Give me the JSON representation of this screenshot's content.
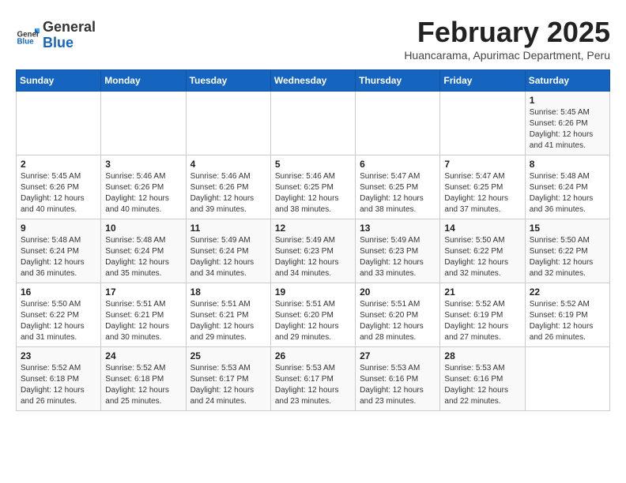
{
  "header": {
    "logo_general": "General",
    "logo_blue": "Blue",
    "month_title": "February 2025",
    "location": "Huancarama, Apurimac Department, Peru"
  },
  "weekdays": [
    "Sunday",
    "Monday",
    "Tuesday",
    "Wednesday",
    "Thursday",
    "Friday",
    "Saturday"
  ],
  "weeks": [
    [
      {
        "day": "",
        "info": ""
      },
      {
        "day": "",
        "info": ""
      },
      {
        "day": "",
        "info": ""
      },
      {
        "day": "",
        "info": ""
      },
      {
        "day": "",
        "info": ""
      },
      {
        "day": "",
        "info": ""
      },
      {
        "day": "1",
        "info": "Sunrise: 5:45 AM\nSunset: 6:26 PM\nDaylight: 12 hours\nand 41 minutes."
      }
    ],
    [
      {
        "day": "2",
        "info": "Sunrise: 5:45 AM\nSunset: 6:26 PM\nDaylight: 12 hours\nand 40 minutes."
      },
      {
        "day": "3",
        "info": "Sunrise: 5:46 AM\nSunset: 6:26 PM\nDaylight: 12 hours\nand 40 minutes."
      },
      {
        "day": "4",
        "info": "Sunrise: 5:46 AM\nSunset: 6:26 PM\nDaylight: 12 hours\nand 39 minutes."
      },
      {
        "day": "5",
        "info": "Sunrise: 5:46 AM\nSunset: 6:25 PM\nDaylight: 12 hours\nand 38 minutes."
      },
      {
        "day": "6",
        "info": "Sunrise: 5:47 AM\nSunset: 6:25 PM\nDaylight: 12 hours\nand 38 minutes."
      },
      {
        "day": "7",
        "info": "Sunrise: 5:47 AM\nSunset: 6:25 PM\nDaylight: 12 hours\nand 37 minutes."
      },
      {
        "day": "8",
        "info": "Sunrise: 5:48 AM\nSunset: 6:24 PM\nDaylight: 12 hours\nand 36 minutes."
      }
    ],
    [
      {
        "day": "9",
        "info": "Sunrise: 5:48 AM\nSunset: 6:24 PM\nDaylight: 12 hours\nand 36 minutes."
      },
      {
        "day": "10",
        "info": "Sunrise: 5:48 AM\nSunset: 6:24 PM\nDaylight: 12 hours\nand 35 minutes."
      },
      {
        "day": "11",
        "info": "Sunrise: 5:49 AM\nSunset: 6:24 PM\nDaylight: 12 hours\nand 34 minutes."
      },
      {
        "day": "12",
        "info": "Sunrise: 5:49 AM\nSunset: 6:23 PM\nDaylight: 12 hours\nand 34 minutes."
      },
      {
        "day": "13",
        "info": "Sunrise: 5:49 AM\nSunset: 6:23 PM\nDaylight: 12 hours\nand 33 minutes."
      },
      {
        "day": "14",
        "info": "Sunrise: 5:50 AM\nSunset: 6:22 PM\nDaylight: 12 hours\nand 32 minutes."
      },
      {
        "day": "15",
        "info": "Sunrise: 5:50 AM\nSunset: 6:22 PM\nDaylight: 12 hours\nand 32 minutes."
      }
    ],
    [
      {
        "day": "16",
        "info": "Sunrise: 5:50 AM\nSunset: 6:22 PM\nDaylight: 12 hours\nand 31 minutes."
      },
      {
        "day": "17",
        "info": "Sunrise: 5:51 AM\nSunset: 6:21 PM\nDaylight: 12 hours\nand 30 minutes."
      },
      {
        "day": "18",
        "info": "Sunrise: 5:51 AM\nSunset: 6:21 PM\nDaylight: 12 hours\nand 29 minutes."
      },
      {
        "day": "19",
        "info": "Sunrise: 5:51 AM\nSunset: 6:20 PM\nDaylight: 12 hours\nand 29 minutes."
      },
      {
        "day": "20",
        "info": "Sunrise: 5:51 AM\nSunset: 6:20 PM\nDaylight: 12 hours\nand 28 minutes."
      },
      {
        "day": "21",
        "info": "Sunrise: 5:52 AM\nSunset: 6:19 PM\nDaylight: 12 hours\nand 27 minutes."
      },
      {
        "day": "22",
        "info": "Sunrise: 5:52 AM\nSunset: 6:19 PM\nDaylight: 12 hours\nand 26 minutes."
      }
    ],
    [
      {
        "day": "23",
        "info": "Sunrise: 5:52 AM\nSunset: 6:18 PM\nDaylight: 12 hours\nand 26 minutes."
      },
      {
        "day": "24",
        "info": "Sunrise: 5:52 AM\nSunset: 6:18 PM\nDaylight: 12 hours\nand 25 minutes."
      },
      {
        "day": "25",
        "info": "Sunrise: 5:53 AM\nSunset: 6:17 PM\nDaylight: 12 hours\nand 24 minutes."
      },
      {
        "day": "26",
        "info": "Sunrise: 5:53 AM\nSunset: 6:17 PM\nDaylight: 12 hours\nand 23 minutes."
      },
      {
        "day": "27",
        "info": "Sunrise: 5:53 AM\nSunset: 6:16 PM\nDaylight: 12 hours\nand 23 minutes."
      },
      {
        "day": "28",
        "info": "Sunrise: 5:53 AM\nSunset: 6:16 PM\nDaylight: 12 hours\nand 22 minutes."
      },
      {
        "day": "",
        "info": ""
      }
    ]
  ]
}
